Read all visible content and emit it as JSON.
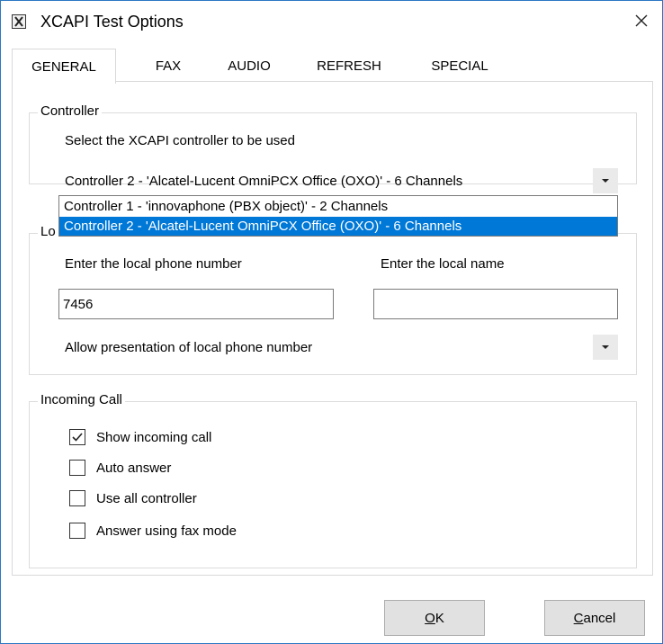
{
  "window": {
    "title": "XCAPI Test Options",
    "app_icon": "xcapi-logo-icon",
    "close_icon": "close-icon"
  },
  "tabs": [
    {
      "label": "GENERAL",
      "active": true
    },
    {
      "label": "FAX",
      "active": false
    },
    {
      "label": "AUDIO",
      "active": false
    },
    {
      "label": "REFRESH",
      "active": false
    },
    {
      "label": "SPECIAL",
      "active": false
    }
  ],
  "controller": {
    "group_label": "Controller",
    "prompt": "Select the XCAPI controller to be used",
    "selected": "Controller 2 - 'Alcatel-Lucent OmniPCX Office (OXO)' - 6 Channels",
    "options": [
      "Controller 1 - 'innovaphone (PBX object)' - 2 Channels",
      "Controller 2 - 'Alcatel-Lucent OmniPCX Office (OXO)' - 6 Channels"
    ],
    "highlighted_option_index": 1
  },
  "local": {
    "group_label_visible": "Lo",
    "phone_label": "Enter the local phone number",
    "phone_value": "7456",
    "name_label": "Enter the local name",
    "name_value": "",
    "presentation_selected": "Allow presentation of local phone number"
  },
  "incoming": {
    "group_label": "Incoming Call",
    "options": [
      {
        "label": "Show incoming call",
        "checked": true
      },
      {
        "label": "Auto answer",
        "checked": false
      },
      {
        "label": "Use all controller",
        "checked": false
      },
      {
        "label": "Answer using fax mode",
        "checked": false
      }
    ]
  },
  "buttons": {
    "ok_label": "OK",
    "ok_mnemonic": "O",
    "ok_rest": "K",
    "cancel_label": "Cancel",
    "cancel_mnemonic": "C",
    "cancel_rest": "ancel"
  },
  "colors": {
    "selection": "#0078d7",
    "window_border": "#2b78c5"
  }
}
